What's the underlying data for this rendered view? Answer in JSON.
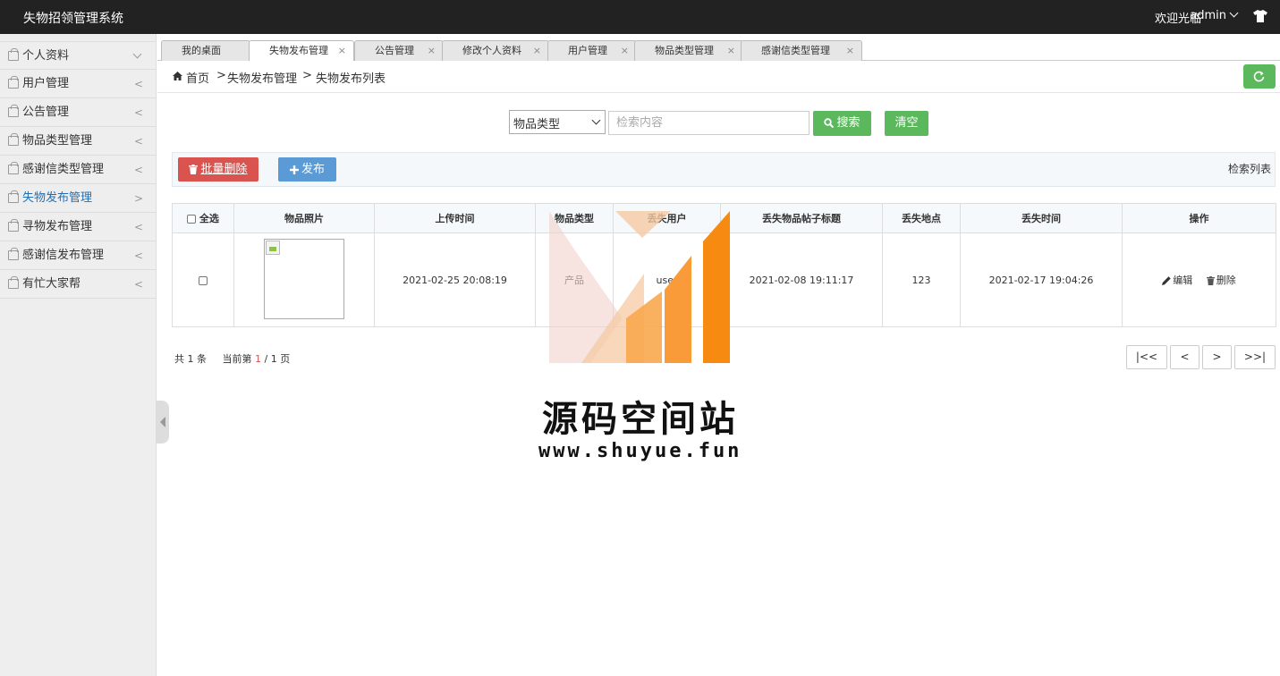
{
  "app": {
    "title": "失物招领管理系统",
    "welcome": "欢迎光临",
    "user": "admin"
  },
  "sidebar": {
    "items": [
      {
        "label": "个人资料",
        "arrow": "down"
      },
      {
        "label": "用户管理",
        "arrow": "<"
      },
      {
        "label": "公告管理",
        "arrow": "<"
      },
      {
        "label": "物品类型管理",
        "arrow": "<"
      },
      {
        "label": "感谢信类型管理",
        "arrow": "<"
      },
      {
        "label": "失物发布管理",
        "arrow": ">"
      },
      {
        "label": "寻物发布管理",
        "arrow": "<"
      },
      {
        "label": "感谢信发布管理",
        "arrow": "<"
      },
      {
        "label": "有忙大家帮",
        "arrow": "<"
      }
    ]
  },
  "tabs": [
    {
      "label": "我的桌面",
      "close": ""
    },
    {
      "label": "失物发布管理",
      "close": "×"
    },
    {
      "label": "公告管理",
      "close": "×"
    },
    {
      "label": "修改个人资料",
      "close": "×"
    },
    {
      "label": "用户管理",
      "close": "×"
    },
    {
      "label": "物品类型管理",
      "close": "×"
    },
    {
      "label": "感谢信类型管理",
      "close": "×"
    }
  ],
  "breadcrumb": {
    "home": "首页",
    "sep1": ">",
    "level1": "失物发布管理",
    "sep2": ">",
    "level2": "失物发布列表"
  },
  "search": {
    "select_value": "物品类型",
    "placeholder": "检索内容",
    "search_label": "搜索",
    "clear_label": "清空"
  },
  "toolbar": {
    "batch_delete": "批量删除",
    "publish": "发布",
    "list_label": "检索列表"
  },
  "table": {
    "headers": {
      "select_all": "全选",
      "photo": "物品照片",
      "upload_time": "上传时间",
      "type": "物品类型",
      "lost_user": "丢失用户",
      "title": "丢失物品帖子标题",
      "place": "丢失地点",
      "lost_time": "丢失时间",
      "ops": "操作"
    },
    "rows": [
      {
        "upload_time": "2021-02-25 20:08:19",
        "type": "产品",
        "lost_user": "user",
        "title": "2021-02-08 19:11:17",
        "place": "123",
        "lost_time": "2021-02-17 19:04:26",
        "edit": "编辑",
        "delete": "删除"
      }
    ]
  },
  "pager": {
    "total_prefix": "共",
    "total": "1",
    "total_suffix": "条",
    "current_prefix": "当前第",
    "current": "1",
    "sep": "/",
    "pages": "1",
    "pages_suffix": "页",
    "first": "|<<",
    "prev": "<",
    "next": ">",
    "last": ">>|"
  },
  "watermark": {
    "title": "源码空间站",
    "url": "www.shuyue.fun"
  },
  "colors": {
    "topbar": "#222222",
    "green": "#5cb85c",
    "red": "#d9534f",
    "blue": "#5b9bd5",
    "active_link": "#1e6fb8"
  }
}
